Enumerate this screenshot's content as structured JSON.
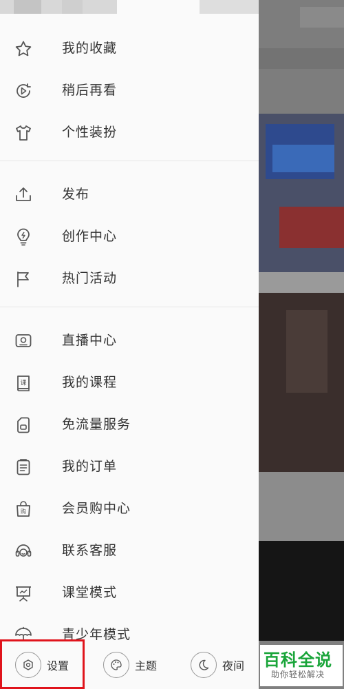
{
  "menu_groups": [
    [
      {
        "label": "我的收藏",
        "icon": "star-icon"
      },
      {
        "label": "稍后再看",
        "icon": "play-later-icon"
      },
      {
        "label": "个性装扮",
        "icon": "tshirt-icon"
      }
    ],
    [
      {
        "label": "发布",
        "icon": "upload-icon"
      },
      {
        "label": "创作中心",
        "icon": "lightbulb-icon"
      },
      {
        "label": "热门活动",
        "icon": "flag-icon"
      }
    ],
    [
      {
        "label": "直播中心",
        "icon": "tv-icon"
      },
      {
        "label": "我的课程",
        "icon": "course-book-icon"
      },
      {
        "label": "免流量服务",
        "icon": "sim-card-icon"
      },
      {
        "label": "我的订单",
        "icon": "order-list-icon"
      },
      {
        "label": "会员购中心",
        "icon": "shopping-bag-icon"
      },
      {
        "label": "联系客服",
        "icon": "headset-icon"
      },
      {
        "label": "课堂模式",
        "icon": "classroom-board-icon"
      },
      {
        "label": "青少年模式",
        "icon": "umbrella-icon"
      }
    ]
  ],
  "bottom": {
    "settings": {
      "label": "设置",
      "icon": "gear-icon"
    },
    "theme": {
      "label": "主题",
      "icon": "palette-icon"
    },
    "night": {
      "label": "夜间",
      "icon": "moon-icon"
    }
  },
  "watermark": {
    "title": "百科全说",
    "subtitle": "助你轻松解决"
  },
  "colors": {
    "highlight": "#e0141c",
    "watermark_green": "#1aa53a",
    "text": "#333333",
    "icon": "#555555"
  }
}
